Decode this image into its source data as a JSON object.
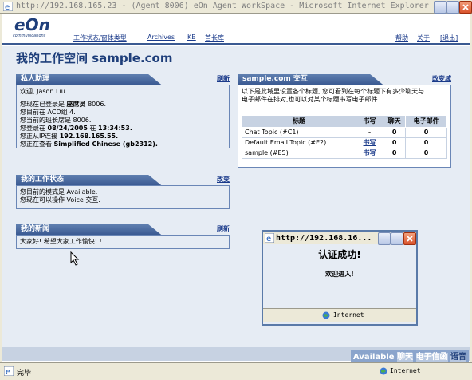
{
  "window": {
    "title": "http://192.168.165.23 - (Agent 8006) eOn Agent WorkSpace - Microsoft Internet Explorer"
  },
  "header": {
    "logo_text": "eOn",
    "logo_subtext": "communications",
    "nav": [
      "工作状态/窗体类型",
      "Archives",
      "KB",
      "首长库"
    ],
    "help_label": "帮助",
    "about_label": "关于",
    "logout_label": "[退出]"
  },
  "page": {
    "title": "我的工作空间 sample.com"
  },
  "assistant_panel": {
    "title": "私人助理",
    "refresh_label": "刷新",
    "greeting": "欢迎, Jason Liu.",
    "line1_prefix": "您现在已登录是 ",
    "line1_role": "座席员",
    "line1_id": " 8006.",
    "line2": "您目前在 ACD组 4.",
    "line3": "您当前的班长席是 8006.",
    "line4_prefix": "您登录在 ",
    "line4_date": "08/24/2005",
    "line4_mid": " 在 ",
    "line4_time": "13:34:53.",
    "line5_prefix": "您正从IP连接 ",
    "line5_ip": "192.168.165.55.",
    "line6_prefix": "您正在查看 ",
    "line6_lang": "Simplified Chinese (gb2312)."
  },
  "status_panel": {
    "title": "我的工作状态",
    "change_label": "改变",
    "line1": "您目前的模式是 Available.",
    "line2": "您现在可以操作 Voice 交互."
  },
  "news_panel": {
    "title": "我的新闻",
    "refresh_label": "刷新",
    "message": "大家好! 希望大家工作愉快! !"
  },
  "interaction_panel": {
    "title": "sample.com 交互",
    "change_label": "改变域",
    "description_line1": "以下是此域里设置各个标题, 您可看到在每个标题下有多少聊天与",
    "description_line2": "电子邮件在排对,也可以对某个标题书写电子邮件.",
    "columns": [
      "标题",
      "书写",
      "聊天",
      "电子邮件"
    ],
    "rows": [
      {
        "topic": "Chat Topic (#C1)",
        "write": "-",
        "chat": "0",
        "email": "0"
      },
      {
        "topic": "Default Email Topic (#E2)",
        "write": "书写",
        "chat": "0",
        "email": "0"
      },
      {
        "topic": "sample (#E5)",
        "write": "书写",
        "chat": "0",
        "email": "0"
      }
    ]
  },
  "availability_bar": {
    "status": "Available",
    "chat": "聊天",
    "email": "电子信函",
    "voice": "语音"
  },
  "popup": {
    "title": "http://192.168.16...",
    "heading": "认证成功!",
    "message": "欢迎进入!",
    "zone_label": "Internet"
  },
  "statusbar": {
    "status_text": "完毕",
    "zone_label": "Internet"
  },
  "colors": {
    "accent": "#3b5a92",
    "panel_bg": "#e6ecf4",
    "link": "#1a3a8a"
  }
}
